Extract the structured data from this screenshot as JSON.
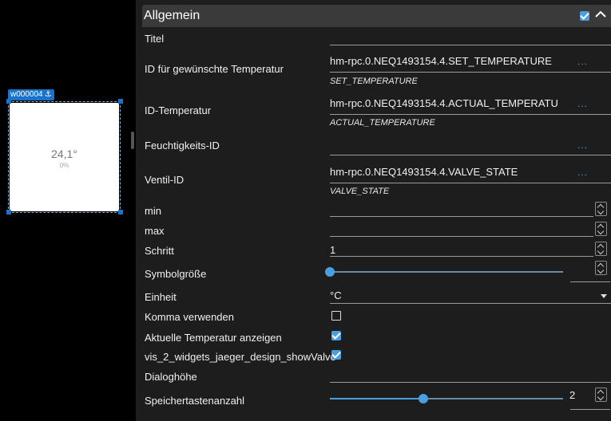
{
  "canvas": {
    "widget_id": "w000004",
    "widget_temperature": "24,1°",
    "widget_percent": "0%"
  },
  "panel": {
    "section_title": "Allgemein",
    "section_enabled": true,
    "fields": {
      "titel": {
        "label": "Titel",
        "value": ""
      },
      "set_temp": {
        "label": "ID für gewünschte Temperatur",
        "value": "hm-rpc.0.NEQ1493154.4.SET_TEMPERATURE",
        "sub": "SET_TEMPERATURE",
        "browse": "..."
      },
      "actual_temp": {
        "label": "ID-Temperatur",
        "value": "hm-rpc.0.NEQ1493154.4.ACTUAL_TEMPERATU",
        "sub": "ACTUAL_TEMPERATURE",
        "browse": "..."
      },
      "humidity": {
        "label": "Feuchtigkeits-ID",
        "value": "",
        "browse": "..."
      },
      "valve": {
        "label": "Ventil-ID",
        "value": "hm-rpc.0.NEQ1493154.4.VALVE_STATE",
        "sub": "VALVE_STATE",
        "browse": "..."
      },
      "min": {
        "label": "min",
        "value": ""
      },
      "max": {
        "label": "max",
        "value": ""
      },
      "schritt": {
        "label": "Schritt",
        "value": "1"
      },
      "symbol": {
        "label": "Symbolgröße",
        "value": "",
        "level": 0
      },
      "einheit": {
        "label": "Einheit",
        "value": "°C"
      },
      "komma": {
        "label": "Komma verwenden",
        "checked": false
      },
      "aktuelle": {
        "label": "Aktuelle Temperatur anzeigen",
        "checked": true
      },
      "showvalve": {
        "label": "vis_2_widgets_jaeger_design_showValve",
        "checked": true
      },
      "dialoghoehe": {
        "label": "Dialoghöhe",
        "value": ""
      },
      "speicher": {
        "label": "Speichertastenanzahl",
        "value": "2",
        "level": 0.4
      }
    }
  },
  "colors": {
    "accent": "#4a9fe0",
    "panel_bg": "#1d1d1d",
    "header_bg": "#3a3a3a"
  },
  "icons": {
    "anchor": "anchor-icon",
    "collapse": "chevron-up-icon",
    "dropdown": "caret-down-icon"
  }
}
